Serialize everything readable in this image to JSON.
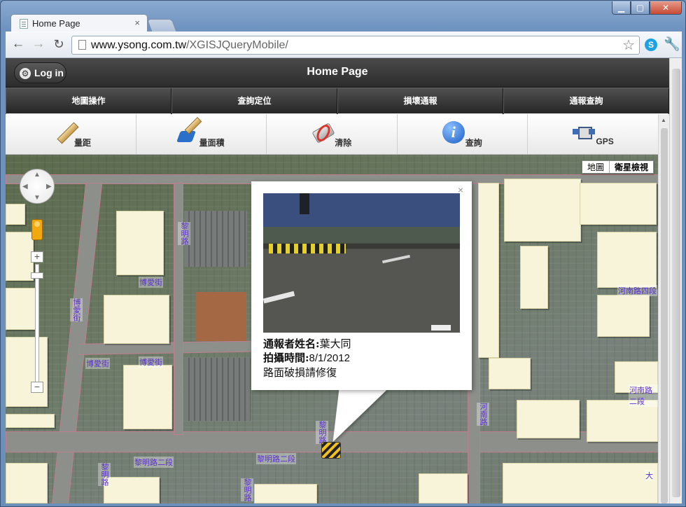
{
  "browser": {
    "tab_title": "Home Page",
    "tab_close": "×",
    "url_host": "www.ysong.com.tw",
    "url_path": "/XGISJQueryMobile/",
    "icons": [
      "page-icon",
      "star-icon",
      "skype-icon",
      "wrench-icon",
      "back-icon",
      "forward-icon",
      "reload-icon"
    ]
  },
  "header": {
    "login_label": "Log in",
    "title": "Home Page"
  },
  "nav": {
    "tabs": [
      "地圖操作",
      "查詢定位",
      "損壞通報",
      "通報查詢"
    ]
  },
  "tools": {
    "items": [
      {
        "label": "量距",
        "icon": "ruler-icon"
      },
      {
        "label": "量面積",
        "icon": "area-icon"
      },
      {
        "label": "清除",
        "icon": "clear-icon"
      },
      {
        "label": "查詢",
        "icon": "info-icon"
      },
      {
        "label": "GPS",
        "icon": "gps-icon"
      }
    ]
  },
  "map": {
    "type_map": "地圖",
    "type_satellite": "衛星檢視",
    "streets": {
      "s1": "博愛街",
      "s2": "博愛街",
      "s3": "博愛街",
      "s4": "博愛街",
      "s5": "黎明路二段",
      "s6": "黎明路二段",
      "s7": "河南路四段",
      "s8": "河南路",
      "s9": "河南路二段",
      "s10": "大",
      "s11": "黎明路",
      "s12": "黎明路",
      "s13": "黎明路",
      "s14": "黎明路"
    }
  },
  "popup": {
    "close": "×",
    "reporter_label": "通報者姓名:",
    "reporter_value": "葉大同",
    "time_label": "拍攝時間:",
    "time_value": "8/1/2012",
    "message": "路面破損請修復"
  }
}
